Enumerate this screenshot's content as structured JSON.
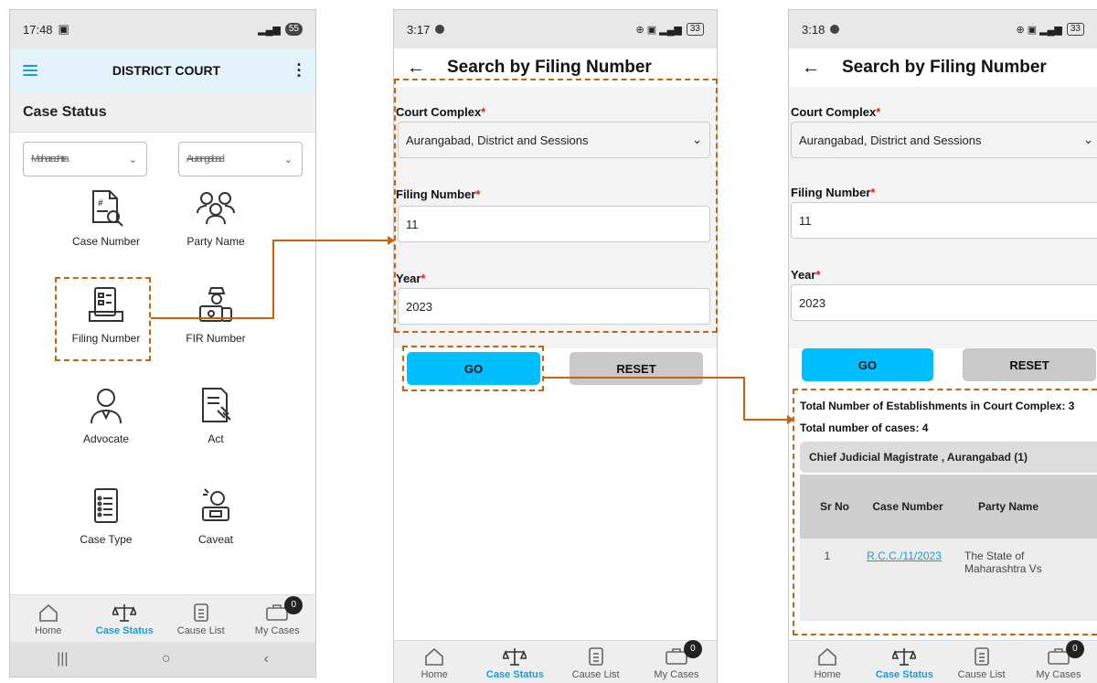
{
  "phone1": {
    "status": {
      "time": "17:48",
      "battery": "55"
    },
    "appbar_title": "DISTRICT COURT",
    "section_title": "Case Status",
    "state_select": "Maharashtra",
    "district_select": "Aurangabad",
    "tiles": [
      {
        "label": "Case Number",
        "icon": "document-search-icon"
      },
      {
        "label": "Party Name",
        "icon": "people-icon"
      },
      {
        "label": "Filing Number",
        "icon": "file-list-icon"
      },
      {
        "label": "FIR Number",
        "icon": "police-fir-icon"
      },
      {
        "label": "Advocate",
        "icon": "advocate-icon"
      },
      {
        "label": "Act",
        "icon": "act-gavel-icon"
      },
      {
        "label": "Case Type",
        "icon": "case-type-icon"
      },
      {
        "label": "Caveat",
        "icon": "caveat-icon"
      }
    ],
    "nav": {
      "home": "Home",
      "case_status": "Case Status",
      "cause_list": "Cause List",
      "my_cases": "My Cases",
      "badge": "0"
    }
  },
  "phone2": {
    "status": {
      "time": "3:17",
      "battery": "33"
    },
    "title": "Search by Filing Number",
    "court_complex_label": "Court Complex",
    "court_complex_value": "Aurangabad, District and Sessions",
    "filing_label": "Filing Number",
    "filing_value": "11",
    "year_label": "Year",
    "year_value": "2023",
    "go": "GO",
    "reset": "RESET",
    "nav": {
      "home": "Home",
      "case_status": "Case Status",
      "cause_list": "Cause List",
      "my_cases": "My Cases",
      "badge": "0"
    }
  },
  "phone3": {
    "status": {
      "time": "3:18",
      "battery": "33"
    },
    "title": "Search by Filing Number",
    "court_complex_label": "Court Complex",
    "court_complex_value": "Aurangabad, District and Sessions",
    "filing_label": "Filing Number",
    "filing_value": "11",
    "year_label": "Year",
    "year_value": "2023",
    "go": "GO",
    "reset": "RESET",
    "total_establishments": "Total Number of Establishments in Court Complex: 3",
    "total_cases": "Total number of cases: 4",
    "establishment": "Chief Judicial Magistrate , Aurangabad (1)",
    "table_headers": {
      "sr": "Sr No",
      "case": "Case Number",
      "party": "Party Name"
    },
    "row": {
      "sr": "1",
      "case": "R.C.C./11/2023",
      "party": "The State of Maharashtra Vs"
    },
    "nav": {
      "home": "Home",
      "case_status": "Case Status",
      "cause_list": "Cause List",
      "my_cases": "My Cases",
      "badge": "0"
    }
  },
  "colors": {
    "accent": "#1a9bd7",
    "go_button": "#00bfff",
    "annotation": "#c9620e",
    "required": "#e02020"
  }
}
